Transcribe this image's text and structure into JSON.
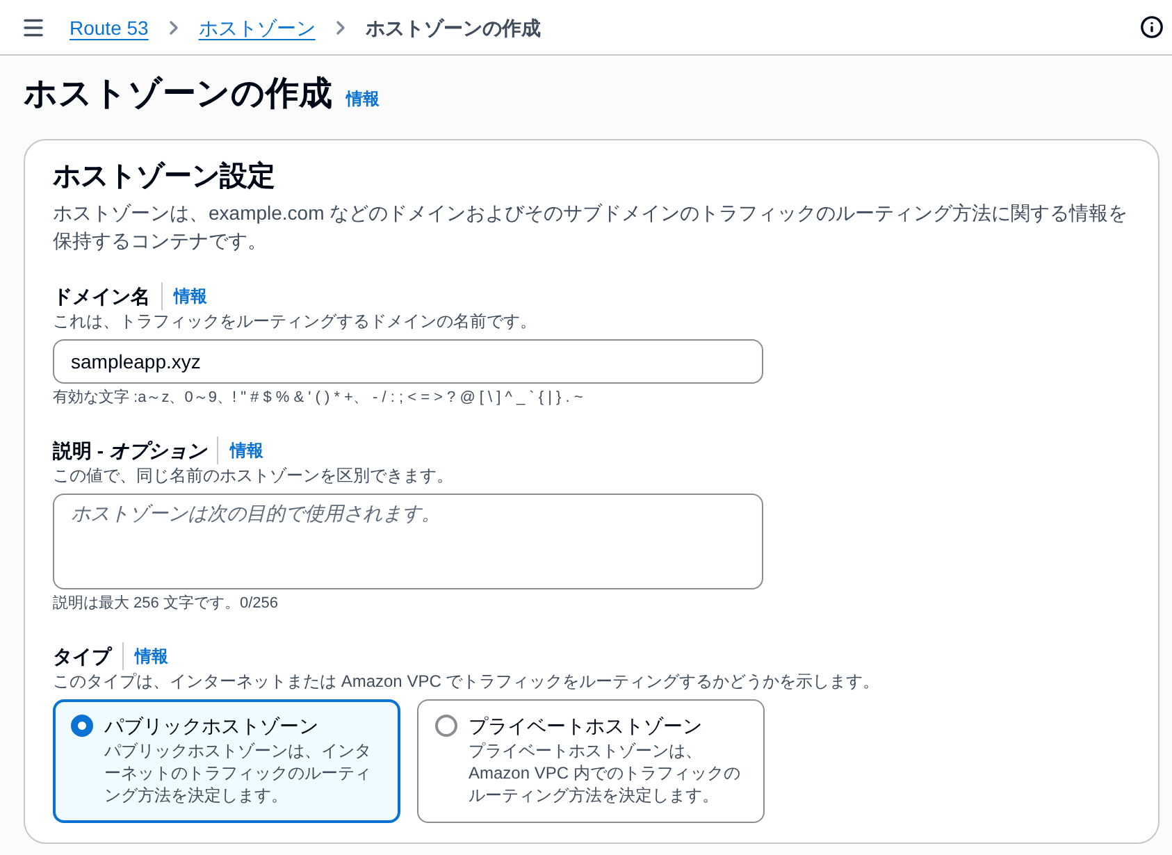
{
  "top_bar": {
    "breadcrumbs": [
      {
        "label": "Route 53",
        "kind": "link"
      },
      {
        "label": "ホストゾーン",
        "kind": "link"
      },
      {
        "label": "ホストゾーンの作成",
        "kind": "current"
      }
    ]
  },
  "page": {
    "title": "ホストゾーンの作成",
    "info_link": "情報"
  },
  "panel": {
    "title": "ホストゾーン設定",
    "description": "ホストゾーンは、example.com などのドメインおよびそのサブドメインのトラフィックのルーティング方法に関する情報を保持するコンテナです。",
    "fields": [
      {
        "kind": "input",
        "label": "ドメイン名",
        "info_link": "情報",
        "hint": "これは、トラフィックをルーティングするドメインの名前です。",
        "value": "sampleapp.xyz",
        "constraint": "有効な文字 :a～z、0～9、! \" # $ % & ' ( ) * +、 - / : ; < = > ? @ [ \\ ] ^ _ ` { | } . ~"
      },
      {
        "kind": "textarea",
        "label": "説明 - *オプション*",
        "info_link": "情報",
        "hint": "この値で、同じ名前のホストゾーンを区別できます。",
        "placeholder": "ホストゾーンは次の目的で使用されます。",
        "constraint": "説明は最大 256 文字です。0/256"
      },
      {
        "kind": "radio_group",
        "label": "タイプ",
        "info_link": "情報",
        "hint": "このタイプは、インターネットまたは Amazon VPC でトラフィックをルーティングするかどうかを示します。",
        "options": [
          {
            "label": "パブリックホストゾーン",
            "description": "パブリックホストゾーンは、インターネットのトラフィックのルーティング方法を決定します。",
            "selected": true
          },
          {
            "label": "プライベートホストゾーン",
            "description": "プライベートホストゾーンは、Amazon VPC 内でのトラフィックのルーティング方法を決定します。",
            "selected": false
          }
        ]
      }
    ]
  }
}
